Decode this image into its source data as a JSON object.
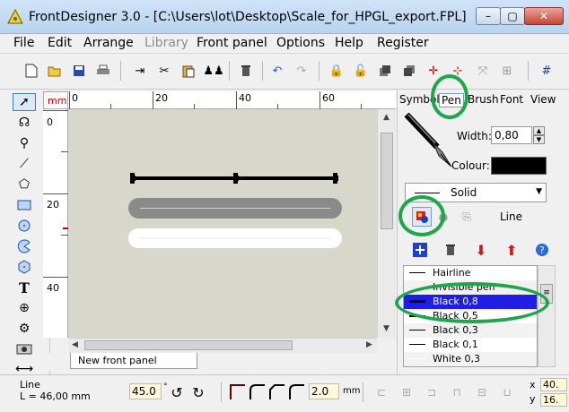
{
  "window": {
    "title": "FrontDesigner 3.0 - [C:\\Users\\lot\\Desktop\\Scale_for_HPGL_export.FPL]",
    "minimize_glyph": "–",
    "maximize_glyph": "▢",
    "close_glyph": "✕"
  },
  "menu": [
    {
      "label": "File",
      "enabled": true
    },
    {
      "label": "Edit",
      "enabled": true
    },
    {
      "label": "Arrange",
      "enabled": true
    },
    {
      "label": "Library",
      "enabled": false
    },
    {
      "label": "Front panel",
      "enabled": true
    },
    {
      "label": "Options",
      "enabled": true
    },
    {
      "label": "Help",
      "enabled": true
    },
    {
      "label": "Register",
      "enabled": true
    }
  ],
  "toolbar_icons": [
    "new-icon",
    "open-icon",
    "save-icon",
    "print-icon",
    "cut-in-icon",
    "cut-icon",
    "paste-icon",
    "group-icon",
    "delete-icon",
    "undo-icon",
    "redo-icon",
    "lock-icon",
    "unlock-icon",
    "bring-front-icon",
    "send-back-icon",
    "crosshair-icon",
    "measure-icon",
    "fit-icon",
    "zoom-icon",
    "grid-icon"
  ],
  "tools": [
    "pointer-icon",
    "arc-tool-icon",
    "zoom-tool-icon",
    "line-tool-icon",
    "polygon-tool-icon",
    "rectangle-tool-icon",
    "circle-tool-icon",
    "pie-tool-icon",
    "hexagon-tool-icon",
    "text-tool-icon",
    "hole-tool-icon",
    "gear-tool-icon",
    "slot-tool-icon",
    "dimension-tool-icon"
  ],
  "rulers": {
    "unit": "mm",
    "horizontal_labels": [
      "0",
      "20",
      "40",
      "60"
    ],
    "vertical_labels": [
      "0",
      "20",
      "40"
    ]
  },
  "canvas": {
    "background": "#d7d7cc",
    "tab_label": "New front panel"
  },
  "panel": {
    "tabs": [
      "Symbols",
      "Pen",
      "Brush",
      "Font",
      "View"
    ],
    "active_tab": "Pen",
    "width_label": "Width:",
    "width_value": "0,80",
    "colour_label": "Colour:",
    "colour_value": "#000000",
    "line_style": "Solid",
    "mode_label": "Line",
    "list": [
      {
        "label": "Hairline",
        "color": "#000000",
        "thickness": 1
      },
      {
        "label": "Invisible pen",
        "color": "#ffffff",
        "thickness": 0
      },
      {
        "label": "Black 0,8",
        "color": "#000000",
        "thickness": 2
      },
      {
        "label": "Black 0,5",
        "color": "#000000",
        "thickness": 1
      },
      {
        "label": "Black 0,3",
        "color": "#000000",
        "thickness": 1
      },
      {
        "label": "Black 0,1",
        "color": "#000000",
        "thickness": 1
      },
      {
        "label": "White 0,3",
        "color": "#ffffff",
        "thickness": 1
      }
    ],
    "selected_index": 2
  },
  "status": {
    "line1": "Line",
    "line2": "L = 46,00 mm",
    "angle_value": "45.0",
    "angle_unit": "°",
    "radius_value": "2.0",
    "radius_unit": "mm",
    "x_label": "x",
    "x_value": "40.",
    "y_label": "y",
    "y_value": "16."
  },
  "accent": {
    "annotation_ring": "#1ea64a",
    "selection": "#1e1ee6"
  }
}
